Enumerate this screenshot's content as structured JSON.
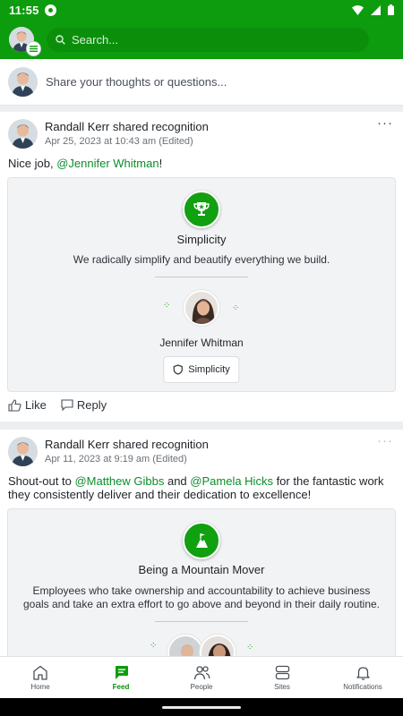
{
  "status_bar": {
    "time": "11:55"
  },
  "header": {
    "search_placeholder": "Search..."
  },
  "composer": {
    "placeholder": "Share your thoughts or questions..."
  },
  "posts": [
    {
      "author": "Randall Kerr",
      "action_text": "shared recognition",
      "date": "Apr 25, 2023 at 10:43 am (Edited)",
      "body_prefix": "Nice job, ",
      "mention_1": "@Jennifer Whitman",
      "body_suffix": "!",
      "recognition": {
        "title": "Simplicity",
        "description": "We radically simplify and beautify everything we build.",
        "recipient": "Jennifer Whitman",
        "tag": "Simplicity"
      },
      "actions": {
        "like": "Like",
        "reply": "Reply"
      }
    },
    {
      "author": "Randall Kerr",
      "action_text": "shared recognition",
      "date": "Apr 11, 2023 at 9:19 am (Edited)",
      "body_prefix": "Shout-out to ",
      "mention_1": "@Matthew Gibbs",
      "body_middle": " and ",
      "mention_2": "@Pamela Hicks",
      "body_suffix": " for the fantastic work they consistently deliver and their dedication to excellence!",
      "recognition": {
        "title": "Being a Mountain Mover",
        "description": "Employees who take ownership and accountability to achieve business goals and take an extra effort to go above and beyond in their daily routine."
      }
    }
  ],
  "bottom_nav": [
    {
      "label": "Home",
      "icon": "home-icon"
    },
    {
      "label": "Feed",
      "icon": "feed-icon",
      "active": true
    },
    {
      "label": "People",
      "icon": "people-icon"
    },
    {
      "label": "Sites",
      "icon": "sites-icon"
    },
    {
      "label": "Notifications",
      "icon": "bell-icon"
    }
  ],
  "colors": {
    "brand": "#0d9c0d",
    "mention": "#0b8d2a"
  }
}
